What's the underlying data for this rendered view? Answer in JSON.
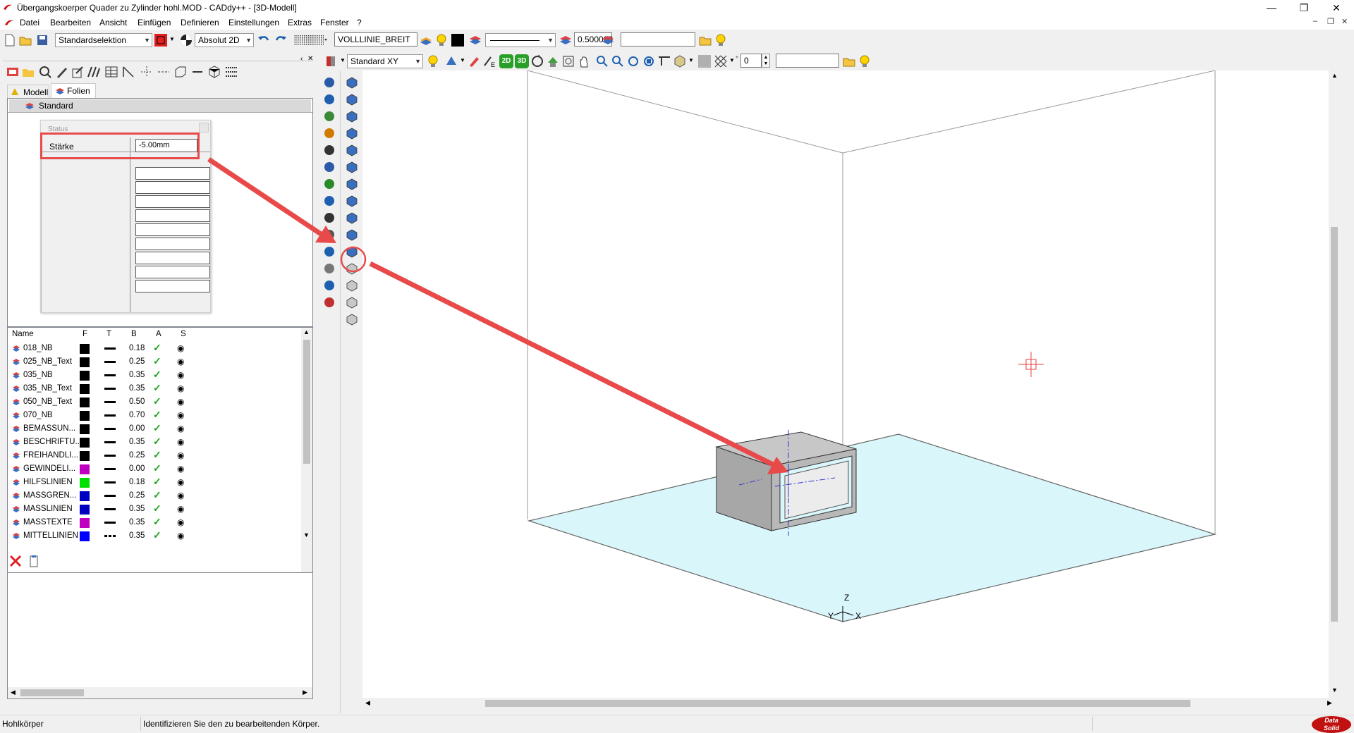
{
  "window": {
    "title": "Übergangskoerper Quader zu Zylinder hohl.MOD  - CADdy++ - [3D-Modell]",
    "minimize_icon": "minimize-icon",
    "maximize_icon": "restore-icon",
    "close_icon": "close-icon"
  },
  "menu": {
    "items": [
      "Datei",
      "Bearbeiten",
      "Ansicht",
      "Einfügen",
      "Definieren",
      "Einstellungen",
      "Extras",
      "Fenster",
      "?"
    ]
  },
  "toolbar1": {
    "selection_mode": "Standardselektion",
    "coord_mode": "Absolut 2D",
    "linetype": "VOLLLINIE_BREIT",
    "linewidth": "0.500000",
    "search_value": ""
  },
  "toolbar2": {
    "view": "Standard XY",
    "counter": "0",
    "search_value": "",
    "view2d_label": "2D",
    "view3d_label": "3D"
  },
  "panel": {
    "tabs": [
      "Modell",
      "Folien"
    ],
    "active_tab": "Folien",
    "tree_root": "Standard",
    "dialog": {
      "status_label": "Status",
      "param_label": "Stärke",
      "param_value": "-5.00mm"
    },
    "layer_table": {
      "columns": [
        "Name",
        "F",
        "T",
        "B",
        "A",
        "S"
      ],
      "rows": [
        {
          "name": "018_NB",
          "color": "#000000",
          "width": "0.18",
          "icon": "layer"
        },
        {
          "name": "025_NB_Text",
          "color": "#000000",
          "width": "0.25",
          "icon": "layer"
        },
        {
          "name": "035_NB",
          "color": "#000000",
          "width": "0.35",
          "icon": "layer"
        },
        {
          "name": "035_NB_Text",
          "color": "#000000",
          "width": "0.35",
          "icon": "layer"
        },
        {
          "name": "050_NB_Text",
          "color": "#000000",
          "width": "0.50",
          "icon": "layer"
        },
        {
          "name": "070_NB",
          "color": "#000000",
          "width": "0.70",
          "icon": "layer"
        },
        {
          "name": "BEMASSUN...",
          "color": "#000000",
          "width": "0.00",
          "icon": "dim"
        },
        {
          "name": "BESCHRIFTU...",
          "color": "#000000",
          "width": "0.35",
          "icon": "text"
        },
        {
          "name": "FREIHANDLI...",
          "color": "#000000",
          "width": "0.25",
          "icon": "layer"
        },
        {
          "name": "GEWINDELI...",
          "color": "#c000c0",
          "width": "0.00",
          "icon": "thread"
        },
        {
          "name": "HILFSLINIEN",
          "color": "#00e000",
          "width": "0.18",
          "icon": "help"
        },
        {
          "name": "MASSGREN...",
          "color": "#0000c0",
          "width": "0.25",
          "icon": "dim"
        },
        {
          "name": "MASSLINIEN",
          "color": "#0000c0",
          "width": "0.35",
          "icon": "dim"
        },
        {
          "name": "MASSTEXTE",
          "color": "#c000c0",
          "width": "0.35",
          "icon": "dim"
        },
        {
          "name": "MITTELLINIEN",
          "color": "#0000ff",
          "width": "0.35",
          "icon": "center"
        }
      ]
    }
  },
  "viewport": {
    "axis_labels": {
      "x": "X",
      "y": "Y",
      "z": "Z"
    },
    "colors": {
      "floor": "#d9f6fa",
      "box": "#a7a7a7",
      "annotation": "#e84040",
      "centerline": "#3333cc"
    }
  },
  "status": {
    "command": "Hohlkörper",
    "prompt": "Identifizieren Sie den zu bearbeitenden Körper.",
    "logo_line1": "Data",
    "logo_line2": "Solid"
  }
}
